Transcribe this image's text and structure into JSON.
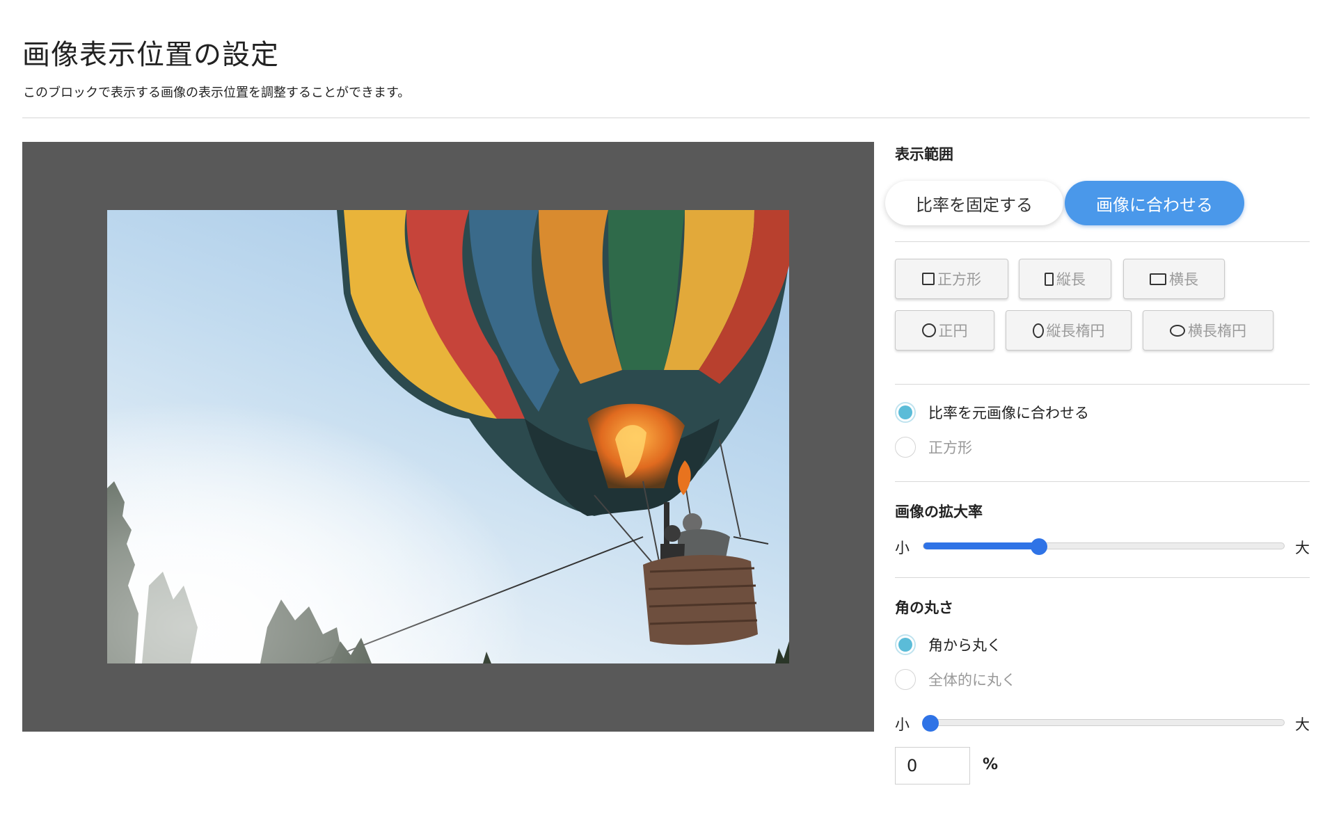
{
  "header": {
    "title": "画像表示位置の設定",
    "description": "このブロックで表示する画像の表示位置を調整することができます。"
  },
  "preview": {
    "image_subject": "hot-air-balloon-photo"
  },
  "panel": {
    "display_range": {
      "label": "表示範囲",
      "toggle": [
        {
          "label": "比率を固定する",
          "active": false
        },
        {
          "label": "画像に合わせる",
          "active": true
        }
      ],
      "shapes_row1": [
        {
          "label": "正方形",
          "icon": "square-icon"
        },
        {
          "label": "縦長",
          "icon": "tall-rectangle-icon"
        },
        {
          "label": "横長",
          "icon": "wide-rectangle-icon"
        }
      ],
      "shapes_row2": [
        {
          "label": "正円",
          "icon": "circle-icon"
        },
        {
          "label": "縦長楕円",
          "icon": "tall-ellipse-icon"
        },
        {
          "label": "横長楕円",
          "icon": "wide-ellipse-icon"
        }
      ],
      "ratio_options": [
        {
          "label": "比率を元画像に合わせる",
          "checked": true
        },
        {
          "label": "正方形",
          "checked": false
        }
      ]
    },
    "zoom": {
      "label": "画像の拡大率",
      "min_label": "小",
      "max_label": "大",
      "value_fraction": 0.32
    },
    "corner": {
      "label": "角の丸さ",
      "options": [
        {
          "label": "角から丸く",
          "checked": true
        },
        {
          "label": "全体的に丸く",
          "checked": false
        }
      ],
      "min_label": "小",
      "max_label": "大",
      "value_fraction": 0.0,
      "input_value": "0",
      "unit": "%"
    }
  },
  "colors": {
    "accent": "#4a98ea",
    "slider": "#2f73e6",
    "radio_checked": "#5bbcd8",
    "preview_bg": "#595959"
  }
}
